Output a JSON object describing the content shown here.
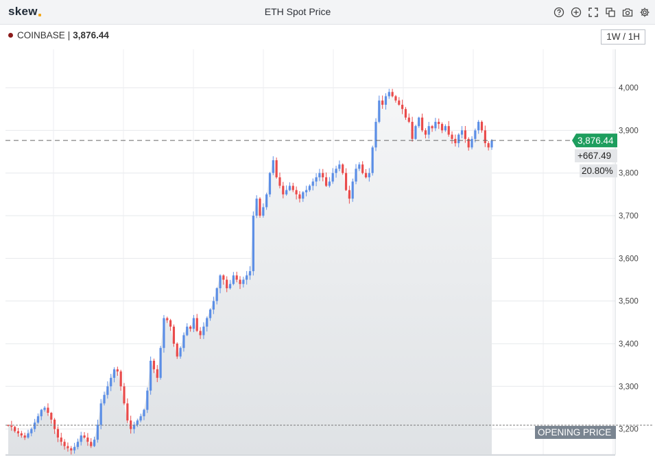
{
  "app": {
    "logo": "skew",
    "title": "ETH Spot Price"
  },
  "toolbar": {
    "icons": [
      "help-icon",
      "add-icon",
      "fullscreen-icon",
      "copy-icon",
      "camera-icon",
      "gear-icon"
    ]
  },
  "legend": {
    "exchange": "COINBASE",
    "separator": "|",
    "price": "3,876.44"
  },
  "interval": {
    "label": "1W / 1H"
  },
  "colors": {
    "up": "#5b8ee6",
    "down": "#e94b4b",
    "last_price_tag": "#1e9e5e",
    "opening_tag": "#7a8591"
  },
  "chart_data": {
    "type": "candlestick",
    "title": "ETH Spot Price",
    "ylim": [
      3140,
      4090
    ],
    "y_ticks": [
      3200,
      3300,
      3400,
      3500,
      3600,
      3700,
      3800,
      3900,
      4000
    ],
    "y_tick_labels": [
      "3,200",
      "3,300",
      "3,400",
      "3,500",
      "3,600",
      "3,700",
      "3,800",
      "3,900",
      "4,000"
    ],
    "grid": true,
    "last_price": 3876.44,
    "last_price_label": "3,876.44",
    "change_label": "+667.49",
    "change_pct_label": "20.80%",
    "opening_price": 3208.95,
    "opening_price_label": "OPENING PRICE",
    "close_path": [
      3208,
      3205,
      3195,
      3190,
      3185,
      3180,
      3190,
      3200,
      3215,
      3230,
      3245,
      3250,
      3238,
      3222,
      3200,
      3180,
      3170,
      3160,
      3155,
      3150,
      3158,
      3170,
      3185,
      3180,
      3170,
      3160,
      3175,
      3210,
      3260,
      3280,
      3300,
      3320,
      3340,
      3335,
      3300,
      3260,
      3220,
      3200,
      3210,
      3220,
      3230,
      3245,
      3290,
      3360,
      3340,
      3320,
      3390,
      3460,
      3455,
      3440,
      3400,
      3370,
      3390,
      3420,
      3440,
      3435,
      3460,
      3430,
      3420,
      3440,
      3460,
      3480,
      3500,
      3530,
      3560,
      3550,
      3530,
      3540,
      3560,
      3550,
      3540,
      3550,
      3560,
      3570,
      3700,
      3740,
      3700,
      3720,
      3750,
      3800,
      3830,
      3790,
      3770,
      3750,
      3760,
      3770,
      3760,
      3750,
      3740,
      3755,
      3760,
      3770,
      3780,
      3790,
      3800,
      3790,
      3770,
      3780,
      3800,
      3810,
      3820,
      3800,
      3760,
      3740,
      3780,
      3810,
      3820,
      3800,
      3790,
      3800,
      3860,
      3920,
      3970,
      3960,
      3980,
      3990,
      3980,
      3970,
      3960,
      3950,
      3930,
      3920,
      3880,
      3910,
      3930,
      3900,
      3890,
      3910,
      3905,
      3920,
      3915,
      3900,
      3910,
      3890,
      3880,
      3870,
      3890,
      3900,
      3880,
      3860,
      3880,
      3900,
      3920,
      3900,
      3870,
      3860,
      3876
    ]
  }
}
